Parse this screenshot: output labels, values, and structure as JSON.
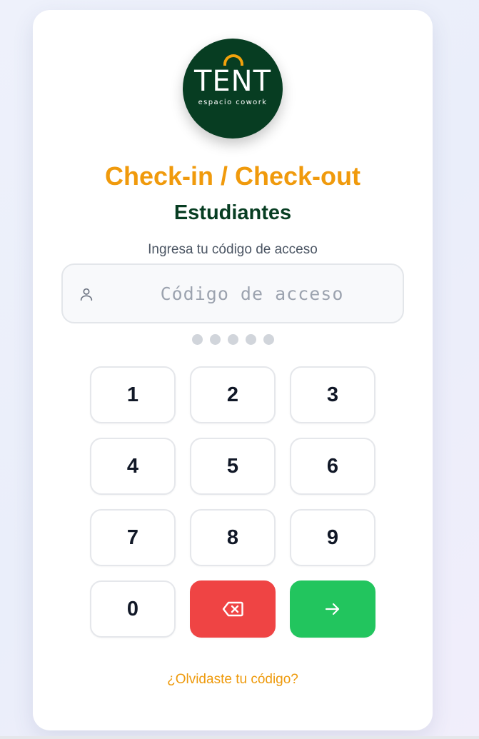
{
  "brand": {
    "logo_word": "TENT",
    "logo_tagline": "espacio cowork",
    "colors": {
      "dark_green": "#073d22",
      "orange": "#f09a0c"
    }
  },
  "header": {
    "title": "Check-in / Check-out",
    "subtitle": "Estudiantes",
    "instruction": "Ingresa tu código de acceso"
  },
  "code_input": {
    "value": "",
    "placeholder": "Código de acceso",
    "icon": "user-icon",
    "digits_entered": 0,
    "digits_total": 5
  },
  "keypad": {
    "keys": [
      "1",
      "2",
      "3",
      "4",
      "5",
      "6",
      "7",
      "8",
      "9",
      "0"
    ],
    "backspace_icon": "backspace-icon",
    "submit_icon": "arrow-right-icon",
    "colors": {
      "backspace": "#ef4444",
      "submit": "#22c55e"
    }
  },
  "footer": {
    "forgot_link": "¿Olvidaste tu código?"
  }
}
